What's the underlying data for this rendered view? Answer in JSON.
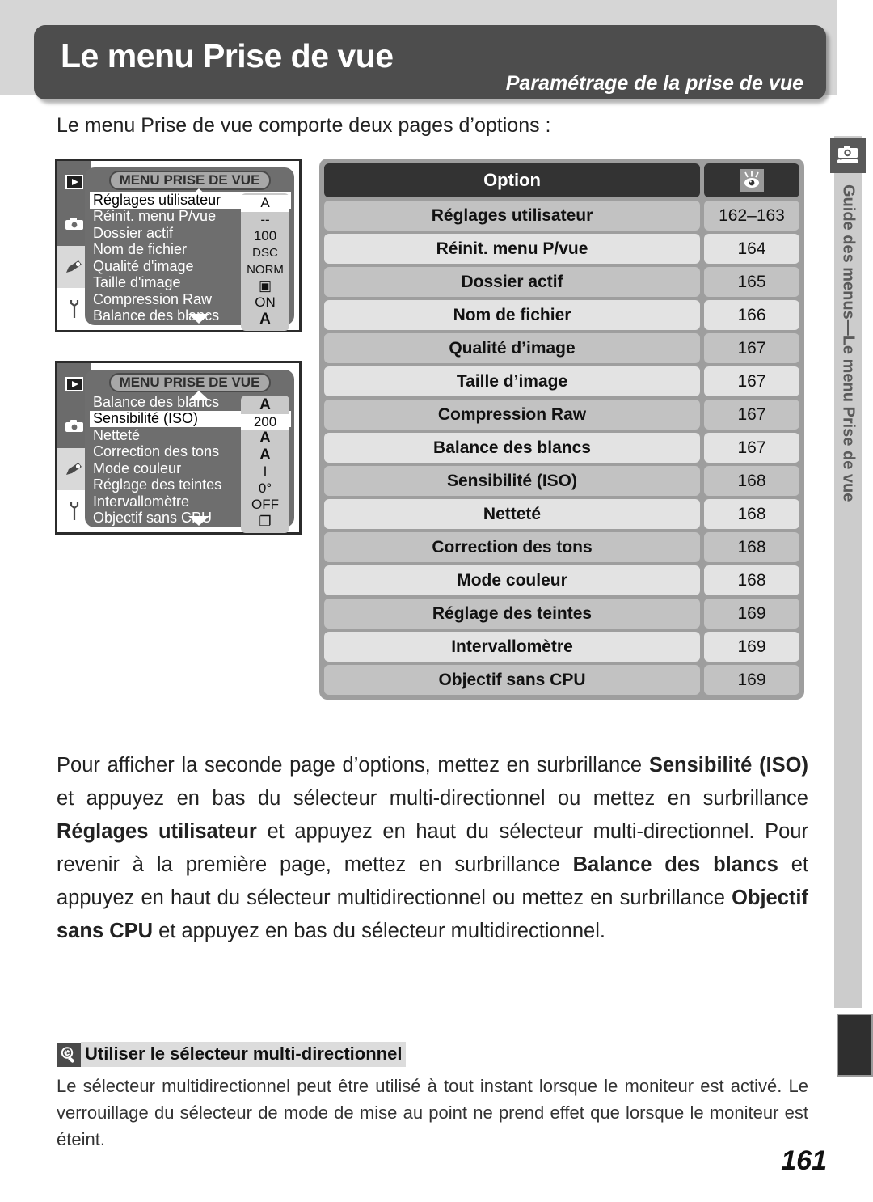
{
  "header": {
    "title": "Le menu Prise de vue",
    "subtitle": "Paramétrage de la prise de vue"
  },
  "intro": "Le menu Prise de vue comporte deux pages d’options :",
  "side_guide": {
    "icon": "camera-icon",
    "text": "Guide des menus—Le menu Prise de vue"
  },
  "lcd_screens": [
    {
      "title": "MENU PRISE DE VUE",
      "tabs": [
        "playback-icon",
        "camera-icon",
        "pencil-icon",
        "wrench-icon"
      ],
      "rows": [
        {
          "label": "Réglages utilisateur",
          "value": "A",
          "selected": true,
          "value_style": "plain"
        },
        {
          "label": "Réinit. menu P/vue",
          "value": "--",
          "selected": false,
          "value_style": "plain"
        },
        {
          "label": "Dossier actif",
          "value": "100",
          "selected": false,
          "value_style": "plain"
        },
        {
          "label": "Nom de fichier",
          "value": "DSC",
          "selected": false,
          "value_style": "small"
        },
        {
          "label": "Qualité d'image",
          "value": "NORM",
          "selected": false,
          "value_style": "small"
        },
        {
          "label": "Taille d'image",
          "value": "▣",
          "selected": false,
          "value_style": "plain"
        },
        {
          "label": "Compression Raw",
          "value": "ON",
          "selected": false,
          "value_style": "plain"
        },
        {
          "label": "Balance des blancs",
          "value": "A",
          "selected": false,
          "value_style": "bold"
        }
      ]
    },
    {
      "title": "MENU PRISE DE VUE",
      "tabs": [
        "playback-icon",
        "camera-icon",
        "pencil-icon",
        "wrench-icon"
      ],
      "rows": [
        {
          "label": "Balance des blancs",
          "value": "A",
          "selected": false,
          "value_style": "bold"
        },
        {
          "label": "Sensibilité (ISO)",
          "value": "200",
          "selected": true,
          "value_style": "plain"
        },
        {
          "label": "Netteté",
          "value": "A",
          "selected": false,
          "value_style": "bold"
        },
        {
          "label": "Correction des tons",
          "value": "A",
          "selected": false,
          "value_style": "bold"
        },
        {
          "label": "Mode couleur",
          "value": "I",
          "selected": false,
          "value_style": "plain"
        },
        {
          "label": "Réglage des teintes",
          "value": "0°",
          "selected": false,
          "value_style": "plain"
        },
        {
          "label": "Intervallomètre",
          "value": "OFF",
          "selected": false,
          "value_style": "plain"
        },
        {
          "label": "Objectif sans CPU",
          "value": "❐",
          "selected": false,
          "value_style": "plain"
        }
      ]
    }
  ],
  "options_table": {
    "header": {
      "option_label": "Option",
      "page_icon": "eye-icon"
    },
    "rows": [
      {
        "option": "Réglages utilisateur",
        "page": "162–163"
      },
      {
        "option": "Réinit. menu P/vue",
        "page": "164"
      },
      {
        "option": "Dossier actif",
        "page": "165"
      },
      {
        "option": "Nom de fichier",
        "page": "166"
      },
      {
        "option": "Qualité d’image",
        "page": "167"
      },
      {
        "option": "Taille d’image",
        "page": "167"
      },
      {
        "option": "Compression Raw",
        "page": "167"
      },
      {
        "option": "Balance des blancs",
        "page": "167"
      },
      {
        "option": "Sensibilité (ISO)",
        "page": "168"
      },
      {
        "option": "Netteté",
        "page": "168"
      },
      {
        "option": "Correction des tons",
        "page": "168"
      },
      {
        "option": "Mode couleur",
        "page": "168"
      },
      {
        "option": "Réglage des teintes",
        "page": "169"
      },
      {
        "option": "Intervallomètre",
        "page": "169"
      },
      {
        "option": "Objectif sans CPU",
        "page": "169"
      }
    ]
  },
  "body_paragraph": {
    "p1": "Pour afficher la seconde page d’options, mettez en surbrillance ",
    "b1": "Sensibilité (ISO)",
    "p2": " et appuyez en bas du sélecteur multi-directionnel ou mettez en surbrillance ",
    "b2": "Réglages utilisateur",
    "p3": " et appuyez en haut du sélecteur multi-directionnel. Pour revenir à la première page, mettez en surbrillance ",
    "b3": "Balance des blancs",
    "p4": " et appuyez en haut du sélecteur multidirectionnel ou mettez en surbrillance ",
    "b4": "Objectif sans CPU",
    "p5": " et appuyez en bas du sélecteur multidirectionnel."
  },
  "note": {
    "icon": "magnifier-icon",
    "title": "Utiliser le sélecteur multi-directionnel",
    "body": "Le sélecteur multidirectionnel peut être utilisé à tout instant lorsque le moniteur est activé. Le verrouillage du sélecteur de mode de mise au point ne prend effet que lorsque le moniteur est éteint."
  },
  "page_number": "161",
  "colors": {
    "header_plate": "#4d4d4d",
    "top_band": "#d6d6d6",
    "table_frame": "#9e9e9e",
    "table_head": "#333333",
    "row_dark": "#c2c2c2",
    "row_light": "#e3e3e3",
    "side_strip": "#cccccc",
    "lcd_body": "#6e6e6e"
  }
}
